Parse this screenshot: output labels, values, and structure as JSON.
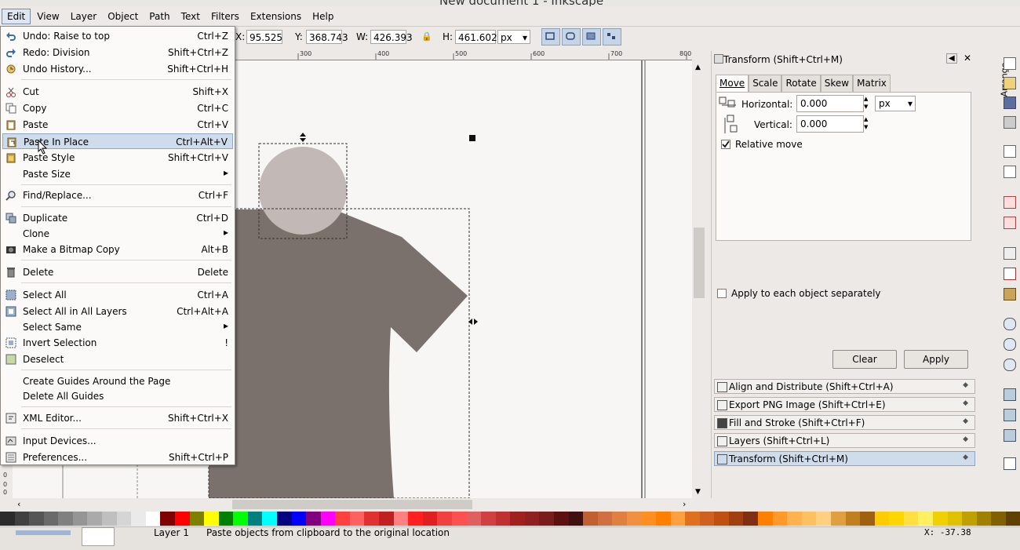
{
  "window": {
    "title": "New document 1 - Inkscape"
  },
  "menubar": [
    "Edit",
    "View",
    "Layer",
    "Object",
    "Path",
    "Text",
    "Filters",
    "Extensions",
    "Help"
  ],
  "toolbar": {
    "x_label": "X:",
    "x_value": "95.525",
    "y_label": "Y:",
    "y_value": "368.743",
    "w_label": "W:",
    "w_value": "426.393",
    "h_label": "H:",
    "h_value": "461.602",
    "unit": "px"
  },
  "ruler": {
    "ticks": [
      "300",
      "400",
      "500",
      "600",
      "700",
      "800"
    ]
  },
  "vruler": {
    "ticks": [
      "0",
      "0",
      "0"
    ]
  },
  "edit_menu": {
    "items": [
      {
        "label": "Undo: Raise to top",
        "shortcut": "Ctrl+Z",
        "icon": "undo-icon"
      },
      {
        "label": "Redo: Division",
        "shortcut": "Shift+Ctrl+Z",
        "icon": "redo-icon"
      },
      {
        "label": "Undo History...",
        "shortcut": "Shift+Ctrl+H",
        "icon": "history-icon"
      },
      {
        "label": "Cut",
        "shortcut": "Shift+X",
        "icon": "cut-icon"
      },
      {
        "label": "Copy",
        "shortcut": "Ctrl+C",
        "icon": "copy-icon"
      },
      {
        "label": "Paste",
        "shortcut": "Ctrl+V",
        "icon": "paste-icon"
      },
      {
        "label": "Paste In Place",
        "shortcut": "Ctrl+Alt+V",
        "icon": "paste-in-place-icon"
      },
      {
        "label": "Paste Style",
        "shortcut": "Shift+Ctrl+V",
        "icon": "paste-style-icon"
      },
      {
        "label": "Paste Size",
        "shortcut": "",
        "icon": ""
      },
      {
        "label": "Find/Replace...",
        "shortcut": "Ctrl+F",
        "icon": "find-icon"
      },
      {
        "label": "Duplicate",
        "shortcut": "Ctrl+D",
        "icon": "duplicate-icon"
      },
      {
        "label": "Clone",
        "shortcut": "",
        "icon": ""
      },
      {
        "label": "Make a Bitmap Copy",
        "shortcut": "Alt+B",
        "icon": "bitmap-icon"
      },
      {
        "label": "Delete",
        "shortcut": "Delete",
        "icon": "delete-icon"
      },
      {
        "label": "Select All",
        "shortcut": "Ctrl+A",
        "icon": "select-all-icon"
      },
      {
        "label": "Select All in All Layers",
        "shortcut": "Ctrl+Alt+A",
        "icon": "select-all-layers-icon"
      },
      {
        "label": "Select Same",
        "shortcut": "",
        "icon": ""
      },
      {
        "label": "Invert Selection",
        "shortcut": "!",
        "icon": "invert-selection-icon"
      },
      {
        "label": "Deselect",
        "shortcut": "",
        "icon": "deselect-icon"
      },
      {
        "label": "Create Guides Around the Page",
        "shortcut": "",
        "icon": ""
      },
      {
        "label": "Delete All Guides",
        "shortcut": "",
        "icon": ""
      },
      {
        "label": "XML Editor...",
        "shortcut": "Shift+Ctrl+X",
        "icon": "xml-editor-icon"
      },
      {
        "label": "Input Devices...",
        "shortcut": "",
        "icon": "input-devices-icon"
      },
      {
        "label": "Preferences...",
        "shortcut": "Shift+Ctrl+P",
        "icon": "preferences-icon"
      }
    ],
    "highlighted": "Paste In Place"
  },
  "transform_panel": {
    "title": "Transform (Shift+Ctrl+M)",
    "tabs": [
      "Move",
      "Scale",
      "Rotate",
      "Skew",
      "Matrix"
    ],
    "active_tab": "Move",
    "horizontal_label": "Horizontal:",
    "horizontal_value": "0.000",
    "vertical_label": "Vertical:",
    "vertical_value": "0.000",
    "unit": "px",
    "relative_move_label": "Relative move",
    "relative_move_checked": true,
    "apply_each_label": "Apply to each object separately",
    "apply_each_checked": false,
    "clear_label": "Clear",
    "apply_label": "Apply"
  },
  "docked_dialogs": [
    {
      "label": "Align and Distribute (Shift+Ctrl+A)",
      "active": false
    },
    {
      "label": "Export PNG Image (Shift+Ctrl+E)",
      "active": false
    },
    {
      "label": "Fill and Stroke (Shift+Ctrl+F)",
      "active": false
    },
    {
      "label": "Layers (Shift+Ctrl+L)",
      "active": false
    },
    {
      "label": "Transform (Shift+Ctrl+M)",
      "active": true
    }
  ],
  "sidebar_label": "Arrange",
  "status": {
    "layer": "Layer 1",
    "message": "Paste objects from clipboard to the original location",
    "coords": "X: -37.38"
  },
  "colors": {
    "shirt": "#7b716c",
    "head": "#c2b9b6",
    "highlight": "#cfdcec",
    "palette": [
      "#2b2b2b",
      "#404040",
      "#555555",
      "#6a6a6a",
      "#808080",
      "#959595",
      "#aaaaaa",
      "#bfbfbf",
      "#d5d5d5",
      "#eaeaea",
      "#ffffff",
      "#800000",
      "#ff0000",
      "#808000",
      "#ffff00",
      "#008000",
      "#00ff00",
      "#008080",
      "#00ffff",
      "#000080",
      "#0000ff",
      "#800080",
      "#ff00ff",
      "#ff4040",
      "#ff6060",
      "#e03030",
      "#c02020",
      "#ff8080",
      "#ff2020",
      "#e02020",
      "#f04040",
      "#ff5050",
      "#e06060",
      "#d04040",
      "#c03030",
      "#a02020",
      "#902020",
      "#7a1c1c",
      "#5c1010",
      "#401010",
      "#c06030",
      "#d07040",
      "#e08040",
      "#f09040",
      "#ff9020",
      "#ff8000",
      "#ffa040",
      "#e07020",
      "#d06020",
      "#c05010",
      "#a04010",
      "#803010",
      "#ff7f00",
      "#ff9a2a",
      "#ffb24e",
      "#ffc060",
      "#ffd080",
      "#e0a040",
      "#c08020",
      "#a06010",
      "#ffcc00",
      "#ffd700",
      "#ffe040",
      "#fff060",
      "#f0d000",
      "#e0c000",
      "#c0a000",
      "#a08000",
      "#806000",
      "#604000"
    ]
  }
}
